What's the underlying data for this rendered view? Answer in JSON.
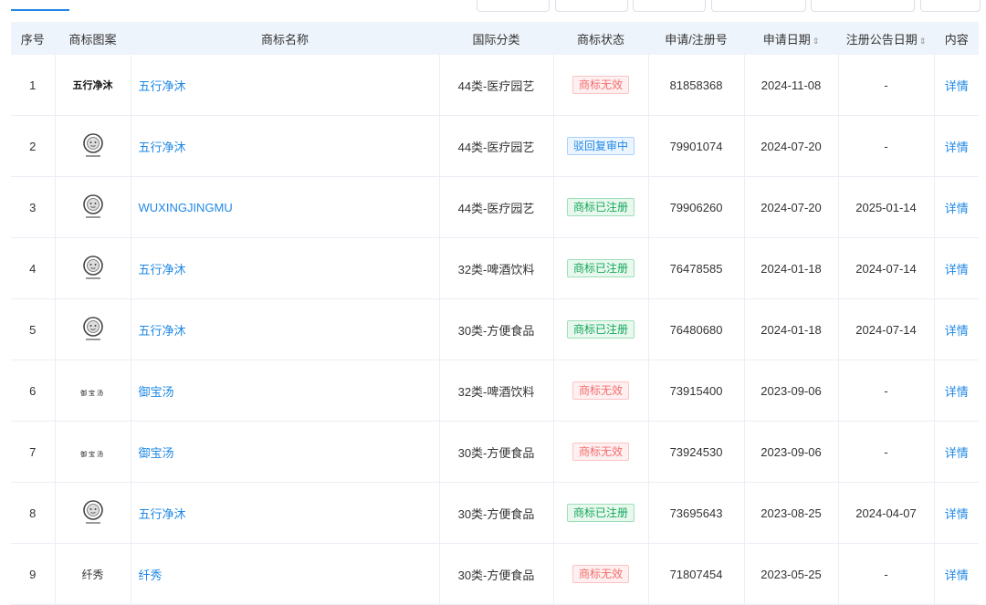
{
  "table": {
    "headers": {
      "index": "序号",
      "logo": "商标图案",
      "name": "商标名称",
      "class": "国际分类",
      "status": "商标状态",
      "reg_no": "申请/注册号",
      "apply_date": "申请日期",
      "pub_date": "注册公告日期",
      "content": "内容"
    },
    "sort_icon": "⇕",
    "rows": [
      {
        "index": "1",
        "logo_type": "text-bold",
        "logo_text": "五行净沐",
        "name": "五行净沐",
        "class": "44类-医疗园艺",
        "status": "商标无效",
        "status_kind": "invalid",
        "reg_no": "81858368",
        "apply_date": "2024-11-08",
        "pub_date": "-",
        "detail": "详情"
      },
      {
        "index": "2",
        "logo_type": "image",
        "logo_text": "",
        "name": "五行净沐",
        "class": "44类-医疗园艺",
        "status": "驳回复审中",
        "status_kind": "review",
        "reg_no": "79901074",
        "apply_date": "2024-07-20",
        "pub_date": "-",
        "detail": "详情"
      },
      {
        "index": "3",
        "logo_type": "image",
        "logo_text": "",
        "name": "WUXINGJINGMU",
        "class": "44类-医疗园艺",
        "status": "商标已注册",
        "status_kind": "registered",
        "reg_no": "79906260",
        "apply_date": "2024-07-20",
        "pub_date": "2025-01-14",
        "detail": "详情"
      },
      {
        "index": "4",
        "logo_type": "image",
        "logo_text": "",
        "name": "五行净沐",
        "class": "32类-啤酒饮料",
        "status": "商标已注册",
        "status_kind": "registered",
        "reg_no": "76478585",
        "apply_date": "2024-01-18",
        "pub_date": "2024-07-14",
        "detail": "详情"
      },
      {
        "index": "5",
        "logo_type": "image",
        "logo_text": "",
        "name": "五行净沐",
        "class": "30类-方便食品",
        "status": "商标已注册",
        "status_kind": "registered",
        "reg_no": "76480680",
        "apply_date": "2024-01-18",
        "pub_date": "2024-07-14",
        "detail": "详情"
      },
      {
        "index": "6",
        "logo_type": "text-small",
        "logo_text": "御宝汤",
        "name": "御宝汤",
        "class": "32类-啤酒饮料",
        "status": "商标无效",
        "status_kind": "invalid",
        "reg_no": "73915400",
        "apply_date": "2023-09-06",
        "pub_date": "-",
        "detail": "详情"
      },
      {
        "index": "7",
        "logo_type": "text-small",
        "logo_text": "御宝汤",
        "name": "御宝汤",
        "class": "30类-方便食品",
        "status": "商标无效",
        "status_kind": "invalid",
        "reg_no": "73924530",
        "apply_date": "2023-09-06",
        "pub_date": "-",
        "detail": "详情"
      },
      {
        "index": "8",
        "logo_type": "image",
        "logo_text": "",
        "name": "五行净沐",
        "class": "30类-方便食品",
        "status": "商标已注册",
        "status_kind": "registered",
        "reg_no": "73695643",
        "apply_date": "2023-08-25",
        "pub_date": "2024-04-07",
        "detail": "详情"
      },
      {
        "index": "9",
        "logo_type": "text-serif",
        "logo_text": "纤秀",
        "name": "纤秀",
        "class": "30类-方便食品",
        "status": "商标无效",
        "status_kind": "invalid",
        "reg_no": "71807454",
        "apply_date": "2023-05-25",
        "pub_date": "-",
        "detail": "详情"
      }
    ]
  },
  "colors": {
    "link": "#1e88e5",
    "header_bg": "#eef4fb",
    "invalid": "#f56c6c",
    "registered": "#13a85a",
    "review": "#1e88e5"
  }
}
